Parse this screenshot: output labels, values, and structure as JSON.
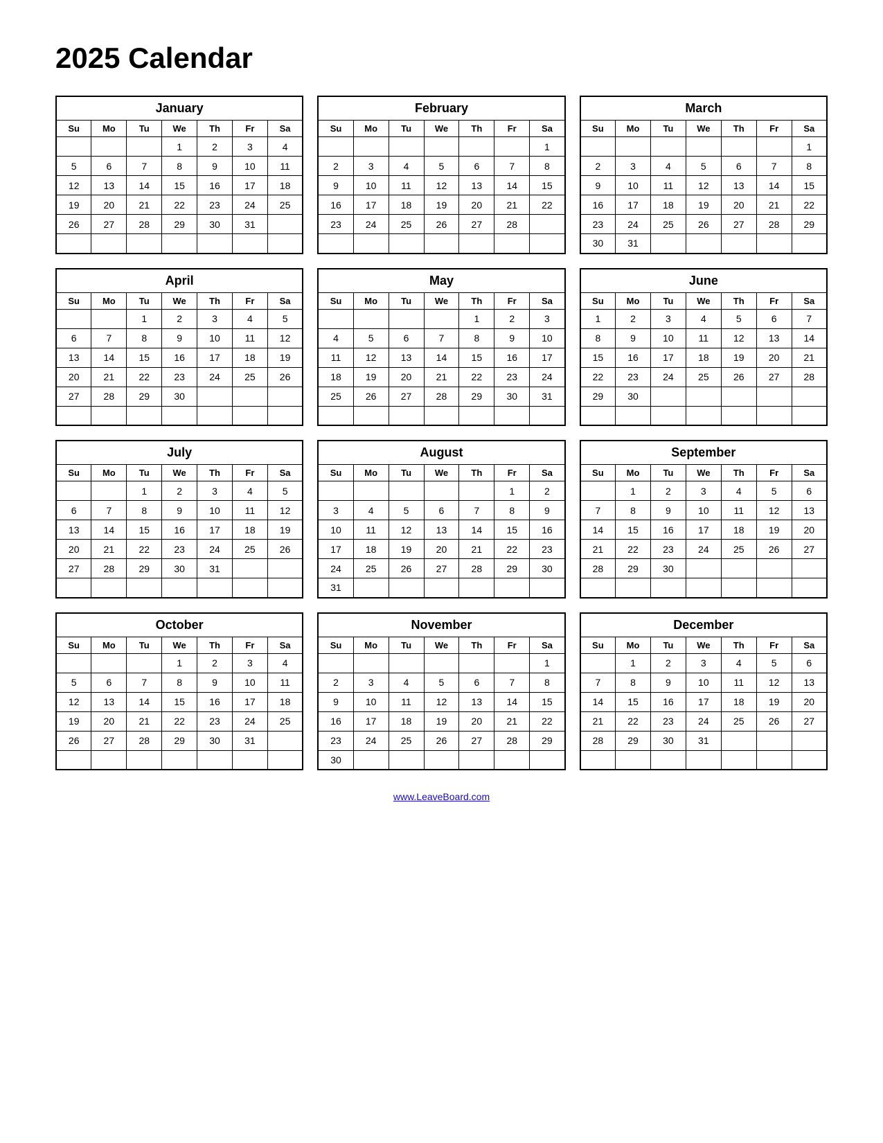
{
  "title": "2025 Calendar",
  "footer_link": "www.LeaveBoard.com",
  "days_header": [
    "Su",
    "Mo",
    "Tu",
    "We",
    "Th",
    "Fr",
    "Sa"
  ],
  "months": [
    {
      "name": "January",
      "weeks": [
        [
          "",
          "",
          "",
          "1",
          "2",
          "3",
          "4"
        ],
        [
          "5",
          "6",
          "7",
          "8",
          "9",
          "10",
          "11"
        ],
        [
          "12",
          "13",
          "14",
          "15",
          "16",
          "17",
          "18"
        ],
        [
          "19",
          "20",
          "21",
          "22",
          "23",
          "24",
          "25"
        ],
        [
          "26",
          "27",
          "28",
          "29",
          "30",
          "31",
          ""
        ],
        [
          "",
          "",
          "",
          "",
          "",
          "",
          ""
        ]
      ]
    },
    {
      "name": "February",
      "weeks": [
        [
          "",
          "",
          "",
          "",
          "",
          "",
          "1"
        ],
        [
          "2",
          "3",
          "4",
          "5",
          "6",
          "7",
          "8"
        ],
        [
          "9",
          "10",
          "11",
          "12",
          "13",
          "14",
          "15"
        ],
        [
          "16",
          "17",
          "18",
          "19",
          "20",
          "21",
          "22"
        ],
        [
          "23",
          "24",
          "25",
          "26",
          "27",
          "28",
          ""
        ],
        [
          "",
          "",
          "",
          "",
          "",
          "",
          ""
        ]
      ]
    },
    {
      "name": "March",
      "weeks": [
        [
          "",
          "",
          "",
          "",
          "",
          "",
          "1"
        ],
        [
          "2",
          "3",
          "4",
          "5",
          "6",
          "7",
          "8"
        ],
        [
          "9",
          "10",
          "11",
          "12",
          "13",
          "14",
          "15"
        ],
        [
          "16",
          "17",
          "18",
          "19",
          "20",
          "21",
          "22"
        ],
        [
          "23",
          "24",
          "25",
          "26",
          "27",
          "28",
          "29"
        ],
        [
          "30",
          "31",
          "",
          "",
          "",
          "",
          ""
        ]
      ]
    },
    {
      "name": "April",
      "weeks": [
        [
          "",
          "",
          "1",
          "2",
          "3",
          "4",
          "5"
        ],
        [
          "6",
          "7",
          "8",
          "9",
          "10",
          "11",
          "12"
        ],
        [
          "13",
          "14",
          "15",
          "16",
          "17",
          "18",
          "19"
        ],
        [
          "20",
          "21",
          "22",
          "23",
          "24",
          "25",
          "26"
        ],
        [
          "27",
          "28",
          "29",
          "30",
          "",
          "",
          ""
        ],
        [
          "",
          "",
          "",
          "",
          "",
          "",
          ""
        ]
      ]
    },
    {
      "name": "May",
      "weeks": [
        [
          "",
          "",
          "",
          "",
          "1",
          "2",
          "3"
        ],
        [
          "4",
          "5",
          "6",
          "7",
          "8",
          "9",
          "10"
        ],
        [
          "11",
          "12",
          "13",
          "14",
          "15",
          "16",
          "17"
        ],
        [
          "18",
          "19",
          "20",
          "21",
          "22",
          "23",
          "24"
        ],
        [
          "25",
          "26",
          "27",
          "28",
          "29",
          "30",
          "31"
        ],
        [
          "",
          "",
          "",
          "",
          "",
          "",
          ""
        ]
      ]
    },
    {
      "name": "June",
      "weeks": [
        [
          "1",
          "2",
          "3",
          "4",
          "5",
          "6",
          "7"
        ],
        [
          "8",
          "9",
          "10",
          "11",
          "12",
          "13",
          "14"
        ],
        [
          "15",
          "16",
          "17",
          "18",
          "19",
          "20",
          "21"
        ],
        [
          "22",
          "23",
          "24",
          "25",
          "26",
          "27",
          "28"
        ],
        [
          "29",
          "30",
          "",
          "",
          "",
          "",
          ""
        ],
        [
          "",
          "",
          "",
          "",
          "",
          "",
          ""
        ]
      ]
    },
    {
      "name": "July",
      "weeks": [
        [
          "",
          "",
          "1",
          "2",
          "3",
          "4",
          "5"
        ],
        [
          "6",
          "7",
          "8",
          "9",
          "10",
          "11",
          "12"
        ],
        [
          "13",
          "14",
          "15",
          "16",
          "17",
          "18",
          "19"
        ],
        [
          "20",
          "21",
          "22",
          "23",
          "24",
          "25",
          "26"
        ],
        [
          "27",
          "28",
          "29",
          "30",
          "31",
          "",
          ""
        ],
        [
          "",
          "",
          "",
          "",
          "",
          "",
          ""
        ]
      ]
    },
    {
      "name": "August",
      "weeks": [
        [
          "",
          "",
          "",
          "",
          "",
          "1",
          "2"
        ],
        [
          "3",
          "4",
          "5",
          "6",
          "7",
          "8",
          "9"
        ],
        [
          "10",
          "11",
          "12",
          "13",
          "14",
          "15",
          "16"
        ],
        [
          "17",
          "18",
          "19",
          "20",
          "21",
          "22",
          "23"
        ],
        [
          "24",
          "25",
          "26",
          "27",
          "28",
          "29",
          "30"
        ],
        [
          "31",
          "",
          "",
          "",
          "",
          "",
          ""
        ]
      ]
    },
    {
      "name": "September",
      "weeks": [
        [
          "",
          "1",
          "2",
          "3",
          "4",
          "5",
          "6"
        ],
        [
          "7",
          "8",
          "9",
          "10",
          "11",
          "12",
          "13"
        ],
        [
          "14",
          "15",
          "16",
          "17",
          "18",
          "19",
          "20"
        ],
        [
          "21",
          "22",
          "23",
          "24",
          "25",
          "26",
          "27"
        ],
        [
          "28",
          "29",
          "30",
          "",
          "",
          "",
          ""
        ],
        [
          "",
          "",
          "",
          "",
          "",
          "",
          ""
        ]
      ]
    },
    {
      "name": "October",
      "weeks": [
        [
          "",
          "",
          "",
          "1",
          "2",
          "3",
          "4"
        ],
        [
          "5",
          "6",
          "7",
          "8",
          "9",
          "10",
          "11"
        ],
        [
          "12",
          "13",
          "14",
          "15",
          "16",
          "17",
          "18"
        ],
        [
          "19",
          "20",
          "21",
          "22",
          "23",
          "24",
          "25"
        ],
        [
          "26",
          "27",
          "28",
          "29",
          "30",
          "31",
          ""
        ],
        [
          "",
          "",
          "",
          "",
          "",
          "",
          ""
        ]
      ]
    },
    {
      "name": "November",
      "weeks": [
        [
          "",
          "",
          "",
          "",
          "",
          "",
          "1"
        ],
        [
          "2",
          "3",
          "4",
          "5",
          "6",
          "7",
          "8"
        ],
        [
          "9",
          "10",
          "11",
          "12",
          "13",
          "14",
          "15"
        ],
        [
          "16",
          "17",
          "18",
          "19",
          "20",
          "21",
          "22"
        ],
        [
          "23",
          "24",
          "25",
          "26",
          "27",
          "28",
          "29"
        ],
        [
          "30",
          "",
          "",
          "",
          "",
          "",
          ""
        ]
      ]
    },
    {
      "name": "December",
      "weeks": [
        [
          "",
          "1",
          "2",
          "3",
          "4",
          "5",
          "6"
        ],
        [
          "7",
          "8",
          "9",
          "10",
          "11",
          "12",
          "13"
        ],
        [
          "14",
          "15",
          "16",
          "17",
          "18",
          "19",
          "20"
        ],
        [
          "21",
          "22",
          "23",
          "24",
          "25",
          "26",
          "27"
        ],
        [
          "28",
          "29",
          "30",
          "31",
          "",
          "",
          ""
        ],
        [
          "",
          "",
          "",
          "",
          "",
          "",
          ""
        ]
      ]
    }
  ]
}
